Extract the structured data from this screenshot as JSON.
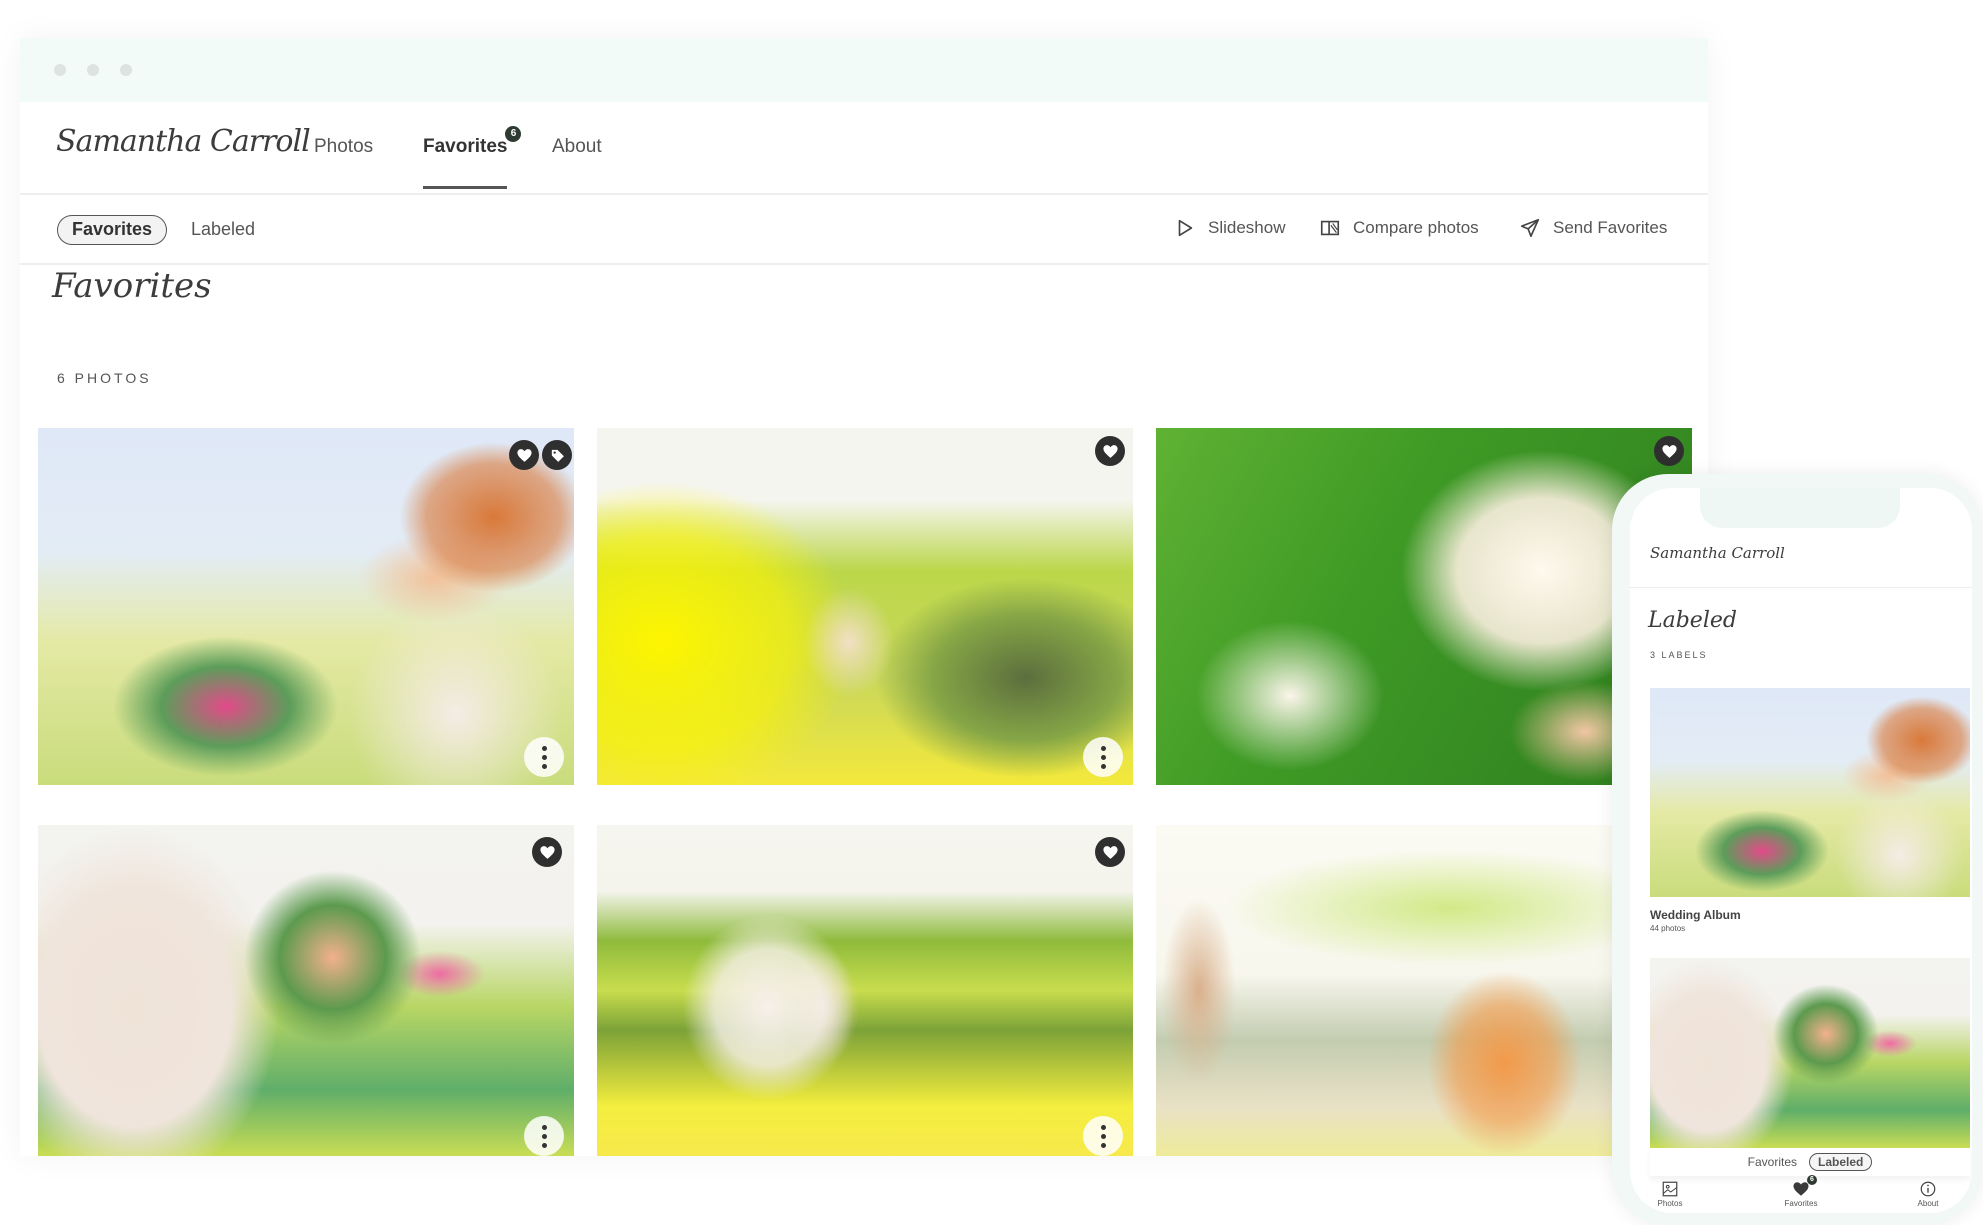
{
  "window": {
    "traffic_lights": [
      "close",
      "minimize",
      "maximize"
    ]
  },
  "nav": {
    "logo": "Samantha Carroll",
    "links": [
      {
        "label": "Photos",
        "active": false
      },
      {
        "label": "Favorites",
        "active": true,
        "badge": "6"
      },
      {
        "label": "About",
        "active": false
      }
    ]
  },
  "subnav": {
    "tabs": [
      {
        "label": "Favorites",
        "active": true
      },
      {
        "label": "Labeled",
        "active": false
      }
    ],
    "actions": [
      {
        "label": "Slideshow",
        "icon": "play-icon"
      },
      {
        "label": "Compare photos",
        "icon": "compare-icon"
      },
      {
        "label": "Send Favorites",
        "icon": "send-icon"
      }
    ]
  },
  "page": {
    "heading": "Favorites",
    "count": "6 PHOTOS"
  },
  "photos": [
    {
      "subject": "bride with colorful bouquet",
      "favorited": true,
      "labeled": true
    },
    {
      "subject": "couple in yellow field",
      "favorited": true,
      "labeled": false
    },
    {
      "subject": "white blossom close-up",
      "favorited": false,
      "labeled": false
    },
    {
      "subject": "bouquet held at waist",
      "favorited": true,
      "labeled": false
    },
    {
      "subject": "bride dancing in field",
      "favorited": true,
      "labeled": false
    },
    {
      "subject": "couple kissing under tree",
      "favorited": false,
      "labeled": false
    }
  ],
  "phone": {
    "logo": "Samantha Carroll",
    "heading": "Labeled",
    "count": "3 LABELS",
    "album": {
      "title": "Wedding Album",
      "count": "44 photos"
    },
    "subtabs": [
      {
        "label": "Favorites",
        "active": false
      },
      {
        "label": "Labeled",
        "active": true
      }
    ],
    "tabbar": [
      {
        "label": "Photos",
        "icon": "image-icon"
      },
      {
        "label": "Favorites",
        "icon": "heart-icon",
        "badge": "6"
      },
      {
        "label": "About",
        "icon": "info-icon"
      }
    ]
  },
  "colors": {
    "accent": "#2e3b33",
    "titlebar": "#f3fbf8",
    "text": "#444444"
  }
}
